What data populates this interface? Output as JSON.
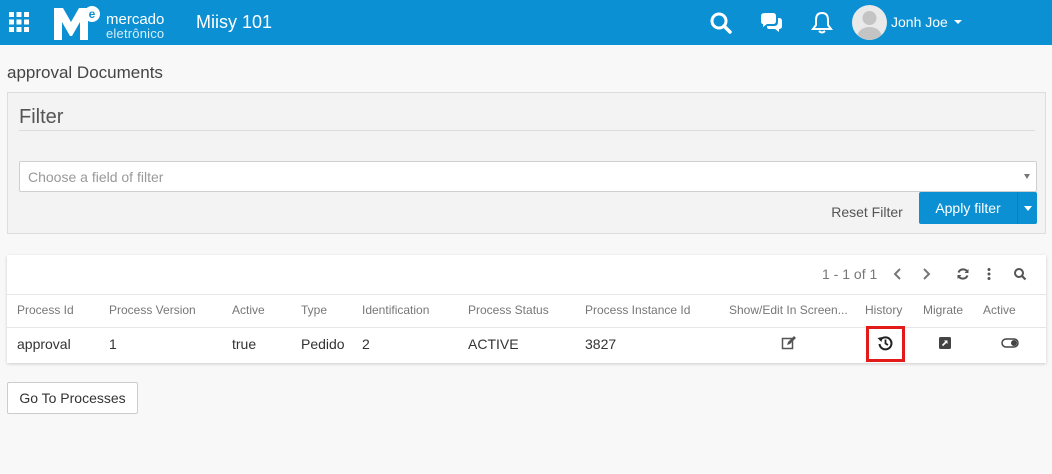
{
  "header": {
    "logo_mark": "M",
    "logo_sup": "e",
    "logo_line1": "mercado",
    "logo_line2": "eletrônico",
    "app_title": "Miisy 101",
    "user_name": "Jonh Joe",
    "icons": [
      "apps-grid-icon",
      "search-icon",
      "chat-icon",
      "bell-icon",
      "user-avatar"
    ]
  },
  "page": {
    "title": "approval Documents"
  },
  "filter": {
    "title": "Filter",
    "placeholder": "Choose a field of filter",
    "reset_label": "Reset Filter",
    "apply_label": "Apply filter"
  },
  "table": {
    "pagination": "1 - 1 of 1",
    "toolbar_icons": [
      "chevron-left-icon",
      "chevron-right-icon",
      "refresh-icon",
      "more-vertical-icon",
      "search-icon"
    ],
    "columns": [
      "Process Id",
      "Process Version",
      "Active",
      "Type",
      "Identification",
      "Process Status",
      "Process Instance Id",
      "Show/Edit In Screen...",
      "History",
      "Migrate",
      "Active"
    ],
    "rows": [
      {
        "process_id": "approval",
        "process_version": "1",
        "active": "true",
        "type": "Pedido",
        "identification": "2",
        "process_status": "ACTIVE",
        "process_instance_id": "3827",
        "row_icons": [
          "edit-icon",
          "history-icon",
          "migrate-icon",
          "toggle-icon"
        ]
      }
    ]
  },
  "footer": {
    "go_to_processes": "Go To Processes"
  },
  "colors": {
    "brand_blue": "#0c90d4",
    "highlight_red": "#e21a1a"
  }
}
